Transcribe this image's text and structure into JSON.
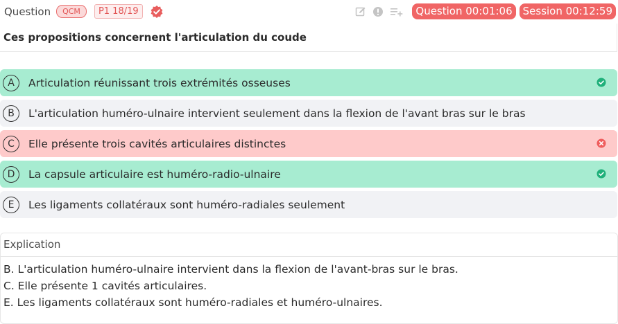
{
  "header": {
    "question_label": "Question",
    "type_badge": "QCM",
    "page_badge": "P1 18/19",
    "question_timer": "Question 00:01:06",
    "session_timer": "Session 00:12:59"
  },
  "question": {
    "text": "Ces propositions concernent l'articulation du coude"
  },
  "options": [
    {
      "letter": "A",
      "text": "Articulation réunissant trois extrémités osseuses",
      "status": "correct"
    },
    {
      "letter": "B",
      "text": "L'articulation huméro-ulnaire intervient seulement dans la flexion de l'avant bras sur le bras",
      "status": "neutral"
    },
    {
      "letter": "C",
      "text": "Elle présente trois cavités articulaires distinctes",
      "status": "wrong"
    },
    {
      "letter": "D",
      "text": "La capsule articulaire est huméro-radio-ulnaire",
      "status": "correct"
    },
    {
      "letter": "E",
      "text": "Les ligaments collatéraux sont huméro-radiales seulement",
      "status": "neutral"
    }
  ],
  "explanation": {
    "title": "Explication",
    "lines": [
      "B. L'articulation huméro-ulnaire intervient dans la flexion de l'avant-bras sur le bras.",
      "C. Elle présente 1 cavités articulaires.",
      "E. Les ligaments collatéraux sont huméro-radiales et huméro-ulnaires."
    ]
  },
  "icons": [
    "verified-check-icon",
    "edit-icon",
    "info-icon",
    "add-to-list-icon",
    "check-circle-icon",
    "x-circle-icon"
  ],
  "colors": {
    "accent": "#f06565",
    "correct_bg": "#a7ecd1",
    "wrong_bg": "#fecaca",
    "neutral_bg": "#f1f2f5",
    "correct_icon": "#1fb07a",
    "wrong_icon": "#ef5d5d"
  }
}
